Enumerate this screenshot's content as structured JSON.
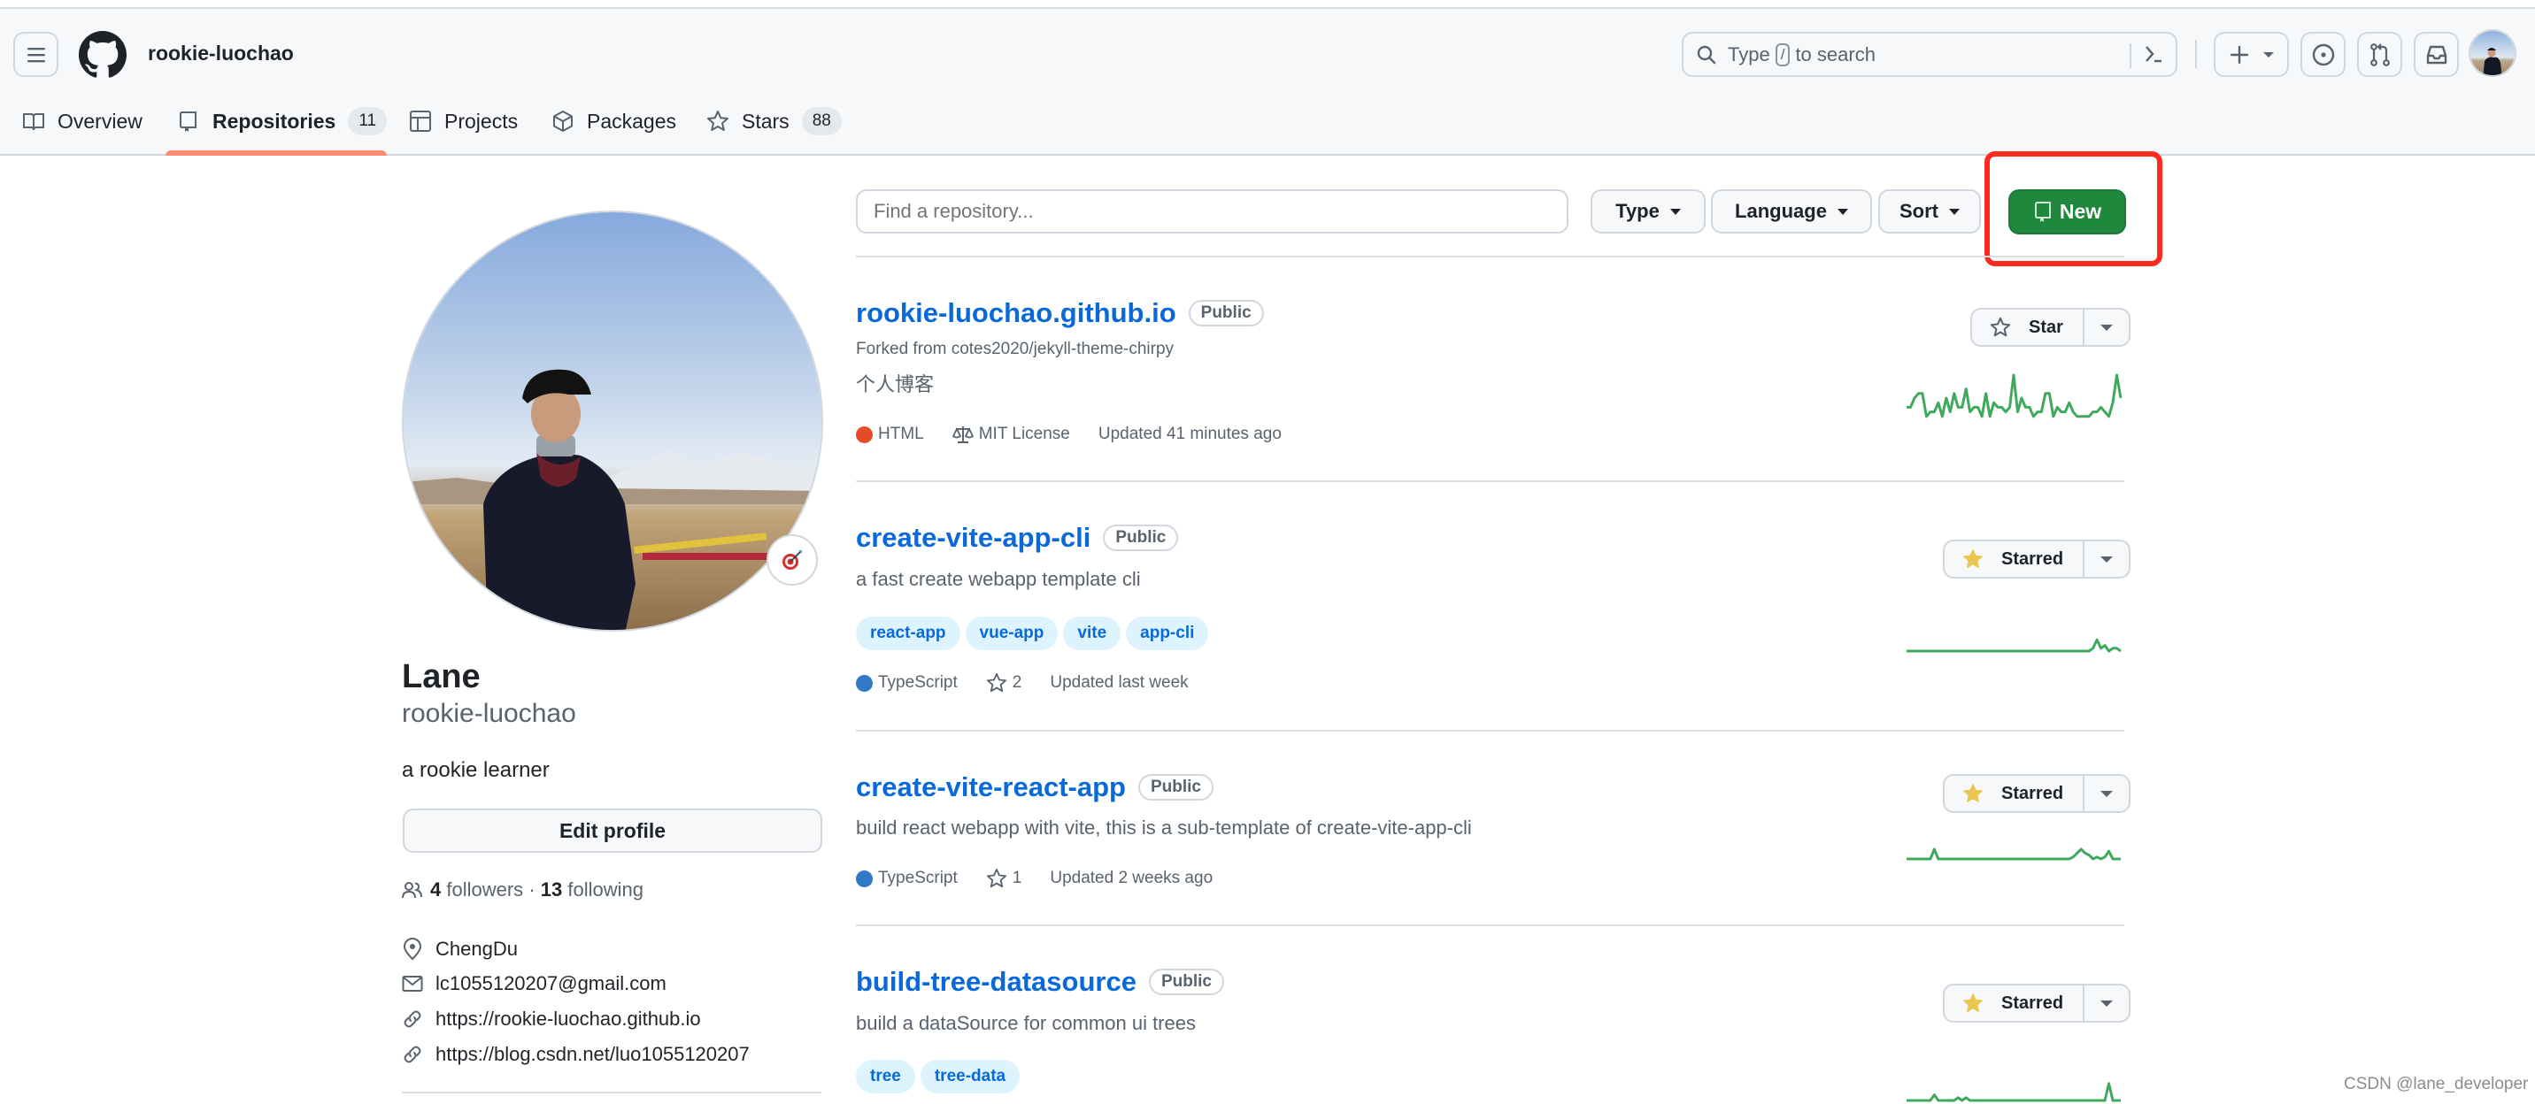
{
  "header": {
    "username": "rookie-luochao",
    "search_placeholder_prefix": "Type",
    "search_key": "/",
    "search_placeholder_suffix": "to search"
  },
  "tabs": [
    {
      "label": "Overview",
      "icon": "book-icon"
    },
    {
      "label": "Repositories",
      "icon": "repo-icon",
      "count": "11",
      "active": true
    },
    {
      "label": "Projects",
      "icon": "table-icon"
    },
    {
      "label": "Packages",
      "icon": "package-icon"
    },
    {
      "label": "Stars",
      "icon": "star-icon",
      "count": "88"
    }
  ],
  "profile": {
    "name": "Lane",
    "login": "rookie-luochao",
    "bio": "a rookie learner",
    "edit_label": "Edit profile",
    "followers_count": "4",
    "followers_label": "followers",
    "separator": "·",
    "following_count": "13",
    "following_label": "following",
    "location": "ChengDu",
    "email": "lc1055120207@gmail.com",
    "links": [
      "https://rookie-luochao.github.io",
      "https://blog.csdn.net/luo1055120207"
    ],
    "status_emoji": "🎯"
  },
  "filters": {
    "search_placeholder": "Find a repository...",
    "type_label": "Type",
    "language_label": "Language",
    "sort_label": "Sort",
    "new_label": "New"
  },
  "repos": [
    {
      "name": "rookie-luochao.github.io",
      "visibility": "Public",
      "forked_from": "Forked from cotes2020/jekyll-theme-chirpy",
      "description": "个人博客",
      "language": "HTML",
      "language_color": "#e34c26",
      "license": "MIT License",
      "updated": "Updated 41 minutes ago",
      "star_label": "Star",
      "starred": false,
      "activity": [
        3,
        3,
        5,
        6,
        6,
        1,
        2,
        2,
        4,
        1,
        5,
        2,
        6,
        3,
        3,
        7,
        2,
        3,
        3,
        1,
        6,
        1,
        4,
        3,
        3,
        2,
        3,
        10,
        2,
        5,
        3,
        3,
        1,
        2,
        2,
        6,
        6,
        1,
        3,
        2,
        2,
        4,
        2,
        1,
        1,
        1,
        1,
        2,
        2,
        3,
        2,
        1,
        4,
        10,
        5
      ]
    },
    {
      "name": "create-vite-app-cli",
      "visibility": "Public",
      "description": "a fast create webapp template cli",
      "topics": [
        "react-app",
        "vue-app",
        "vite",
        "app-cli"
      ],
      "language": "TypeScript",
      "language_color": "#3178c6",
      "stars": "2",
      "updated": "Updated last week",
      "star_label": "Starred",
      "starred": true,
      "activity": [
        0,
        0,
        0,
        0,
        0,
        0,
        0,
        0,
        0,
        0,
        0,
        0,
        0,
        0,
        0,
        0,
        0,
        0,
        0,
        0,
        0,
        0,
        0,
        0,
        0,
        0,
        0,
        0,
        0,
        0,
        0,
        0,
        0,
        0,
        0,
        0,
        0,
        0,
        0,
        0,
        0,
        0,
        0,
        0,
        0,
        0,
        0,
        1,
        4,
        1,
        2,
        0,
        1,
        1,
        0
      ]
    },
    {
      "name": "create-vite-react-app",
      "visibility": "Public",
      "description": "build react webapp with vite, this is a sub-template of create-vite-app-cli",
      "language": "TypeScript",
      "language_color": "#3178c6",
      "stars": "1",
      "updated": "Updated 2 weeks ago",
      "star_label": "Starred",
      "starred": true,
      "activity": [
        0,
        0,
        0,
        0,
        0,
        0,
        0,
        5,
        0,
        0,
        0,
        0,
        0,
        0,
        0,
        0,
        0,
        0,
        0,
        0,
        0,
        0,
        0,
        0,
        0,
        0,
        0,
        0,
        0,
        0,
        0,
        0,
        0,
        0,
        0,
        0,
        0,
        0,
        0,
        0,
        0,
        0,
        1,
        3,
        5,
        3,
        2,
        0,
        1,
        0,
        1,
        4,
        0,
        0,
        0
      ]
    },
    {
      "name": "build-tree-datasource",
      "visibility": "Public",
      "description": "build a dataSource for common ui trees",
      "topics": [
        "tree",
        "tree-data"
      ],
      "star_label": "Starred",
      "starred": true,
      "activity": [
        0,
        0,
        0,
        0,
        0,
        0,
        0,
        2,
        0,
        0,
        0,
        0,
        0,
        1,
        0,
        1,
        0,
        0,
        0,
        0,
        0,
        0,
        0,
        0,
        0,
        0,
        0,
        0,
        0,
        0,
        0,
        0,
        0,
        0,
        0,
        0,
        0,
        0,
        0,
        0,
        0,
        0,
        0,
        0,
        0,
        0,
        0,
        0,
        0,
        0,
        0,
        6,
        0,
        0,
        0
      ]
    }
  ],
  "watermark": "CSDN @lane_developer",
  "colors": {
    "accent_link": "#0969da",
    "primary_button": "#1f883d",
    "tab_underline": "#fd8c73",
    "highlight_box": "#ff2a1f",
    "starred_star": "#eac54f",
    "sparkline": "#40a95e"
  }
}
